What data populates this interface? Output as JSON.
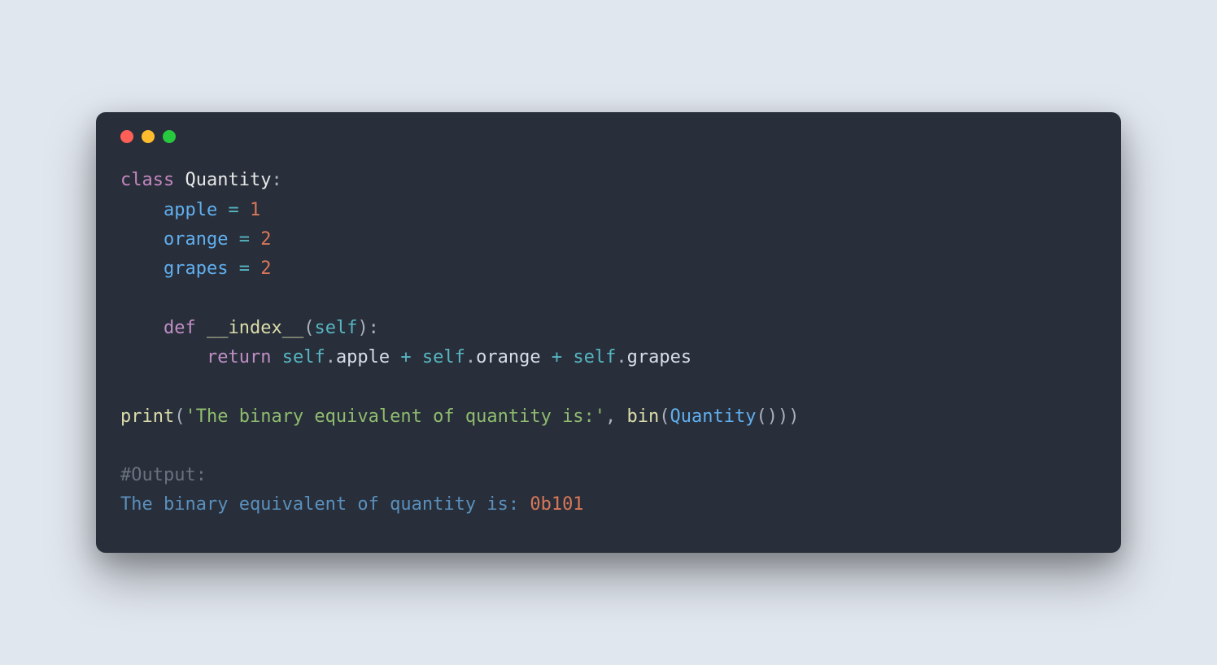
{
  "window": {
    "traffic_light_colors": {
      "close": "#ff5f56",
      "minimize": "#ffbd2e",
      "maximize": "#27c93f"
    }
  },
  "code": {
    "l1": {
      "class": "class",
      "name": "Quantity",
      "colon": ":"
    },
    "l2": {
      "indent": "    ",
      "prop": "apple",
      "op": " = ",
      "val": "1"
    },
    "l3": {
      "indent": "    ",
      "prop": "orange",
      "op": " = ",
      "val": "2"
    },
    "l4": {
      "indent": "    ",
      "prop": "grapes",
      "op": " = ",
      "val": "2"
    },
    "l5": {
      "indent": "    ",
      "def": "def",
      "sp": " ",
      "fn": "__index__",
      "lp": "(",
      "param": "self",
      "rp": "):"
    },
    "l6": {
      "indent": "        ",
      "ret": "return",
      "sp": " ",
      "s1": "self",
      "d1": ".",
      "p1": "apple",
      "plus": " + ",
      "s2": "self",
      "d2": ".",
      "p2": "orange",
      "plus2": " + ",
      "s3": "self",
      "d3": ".",
      "p3": "grapes"
    },
    "l7": {
      "print": "print",
      "lp": "(",
      "str": "'The binary equivalent of quantity is:'",
      "comma": ", ",
      "bin": "bin",
      "lp2": "(",
      "type": "Quantity",
      "call": "()))"
    },
    "l8": {
      "comment": "#Output:"
    },
    "l9": {
      "text": "The binary equivalent of quantity is: ",
      "num": "0b101"
    }
  }
}
